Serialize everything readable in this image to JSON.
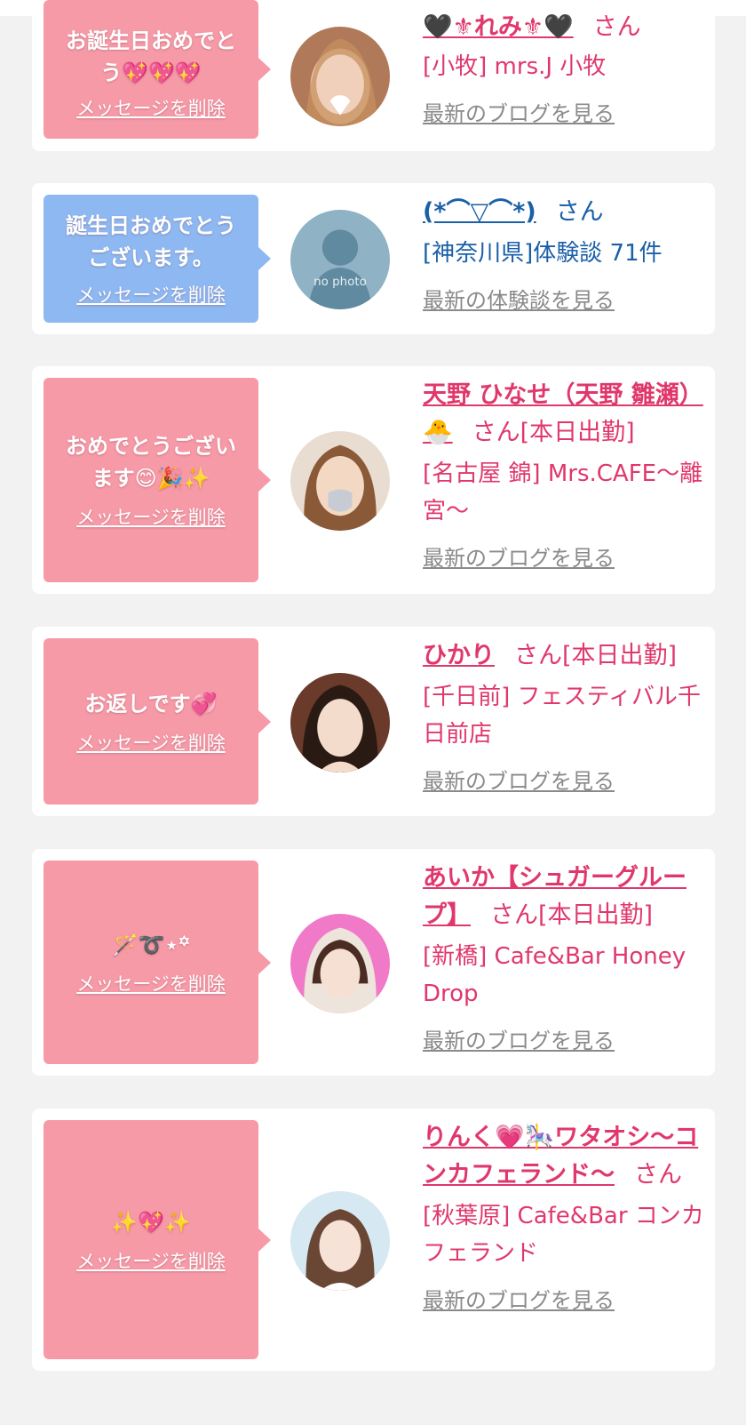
{
  "common": {
    "delete_label": "メッセージを削除",
    "san": "さん",
    "today_badge": "[本日出勤]"
  },
  "colors": {
    "pink_bubble": "#f79aa8",
    "blue_bubble": "#8eb8f2",
    "name_pink": "#e0386c",
    "name_blue": "#1a5fa8",
    "link_gray": "#8a8a8a"
  },
  "cards": [
    {
      "message": "お誕生日おめでとう💖💖💖",
      "name": "🖤⚜れみ⚜🖤",
      "shop": "[小牧] mrs.J 小牧",
      "blog_link": "最新のブログを見る"
    },
    {
      "message": "誕生日おめでとうございます。",
      "name": "(*⌒▽⌒*)",
      "shop": "[神奈川県]体験談 71件",
      "blog_link": "最新の体験談を見る",
      "avatar_label": "no photo"
    },
    {
      "message": "おめでとうございます😊🎉✨",
      "name": "天野 ひなせ（天野 雛瀬）🐣",
      "shop": "[名古屋 錦] Mrs.CAFE〜離宮〜",
      "blog_link": "最新のブログを見る"
    },
    {
      "message": "お返しです💞",
      "name": "ひかり",
      "shop": "[千日前] フェスティバル千日前店",
      "blog_link": "最新のブログを見る"
    },
    {
      "message": "🪄➰⋆꙳",
      "name": "あいか【シュガーグループ】",
      "shop": "[新橋] Cafe&Bar Honey Drop",
      "blog_link": "最新のブログを見る"
    },
    {
      "message": "✨💖✨",
      "name": "りんく💗🎠ワタオシ〜コンカフェランド〜",
      "shop": "[秋葉原] Cafe&Bar コンカフェランド",
      "blog_link": "最新のブログを見る"
    }
  ]
}
